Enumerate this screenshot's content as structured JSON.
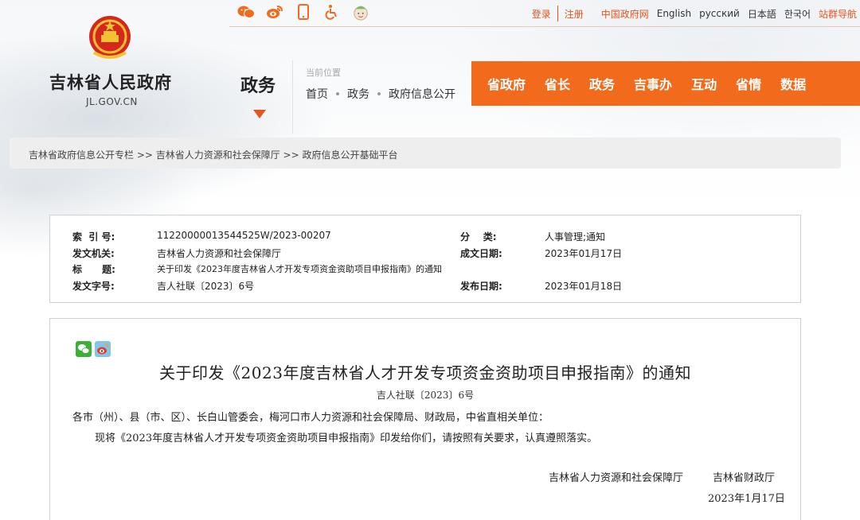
{
  "top_icons": [
    "wechat-icon",
    "weibo-icon",
    "mobile-icon",
    "accessibility-icon",
    "elderly-mode-icon"
  ],
  "top_links": {
    "login": "登录",
    "register": "注册",
    "gov_cn": "中国政府网",
    "english": "English",
    "russian": "русский",
    "japanese": "日本語",
    "korean": "한국어",
    "site_nav": "站群导航"
  },
  "logo": {
    "name": "吉林省人民政府",
    "domain": "JL.GOV.CN"
  },
  "section": {
    "name": "政务"
  },
  "location": {
    "label": "当前位置",
    "crumbs": [
      "首页",
      "政务",
      "政府信息公开"
    ]
  },
  "main_nav": [
    "省政府",
    "省长",
    "政务",
    "吉事办",
    "互动",
    "省情",
    "数据"
  ],
  "breadcrumb": "吉林省政府信息公开专栏 >> 吉林省人力资源和社会保障厅 >> 政府信息公开基础平台",
  "meta": {
    "index_no_label": "索  引 号:",
    "index_no": "11220000013544525W/2023-00207",
    "category_label": "分    类:",
    "category": "人事管理;通知",
    "issuer_label": "发文机关:",
    "issuer": "吉林省人力资源和社会保障厅",
    "written_date_label": "成文日期:",
    "written_date": "2023年01月17日",
    "title_label": "标      题:",
    "title": "关于印发《2023年度吉林省人才开发专项资金资助项目申报指南》的通知",
    "doc_no_label": "发文字号:",
    "doc_no": "吉人社联〔2023〕6号",
    "publish_date_label": "发布日期:",
    "publish_date": "2023年01月18日"
  },
  "article": {
    "title": "关于印发《2023年度吉林省人才开发专项资金资助项目申报指南》的通知",
    "doc_no": "吉人社联〔2023〕6号",
    "recipients": "各市（州）、县（市、区）、长白山管委会，梅河口市人力资源和社会保障局、财政局，中省直相关单位：",
    "body": "现将《2023年度吉林省人才开发专项资金资助项目申报指南》印发给你们，请按照有关要求，认真遵照落实。",
    "signer_1": "吉林省人力资源和社会保障厅",
    "signer_2": "吉林省财政厅",
    "date": "2023年1月17日"
  },
  "colors": {
    "accent": "#f26b1d",
    "link": "#e4551f"
  }
}
